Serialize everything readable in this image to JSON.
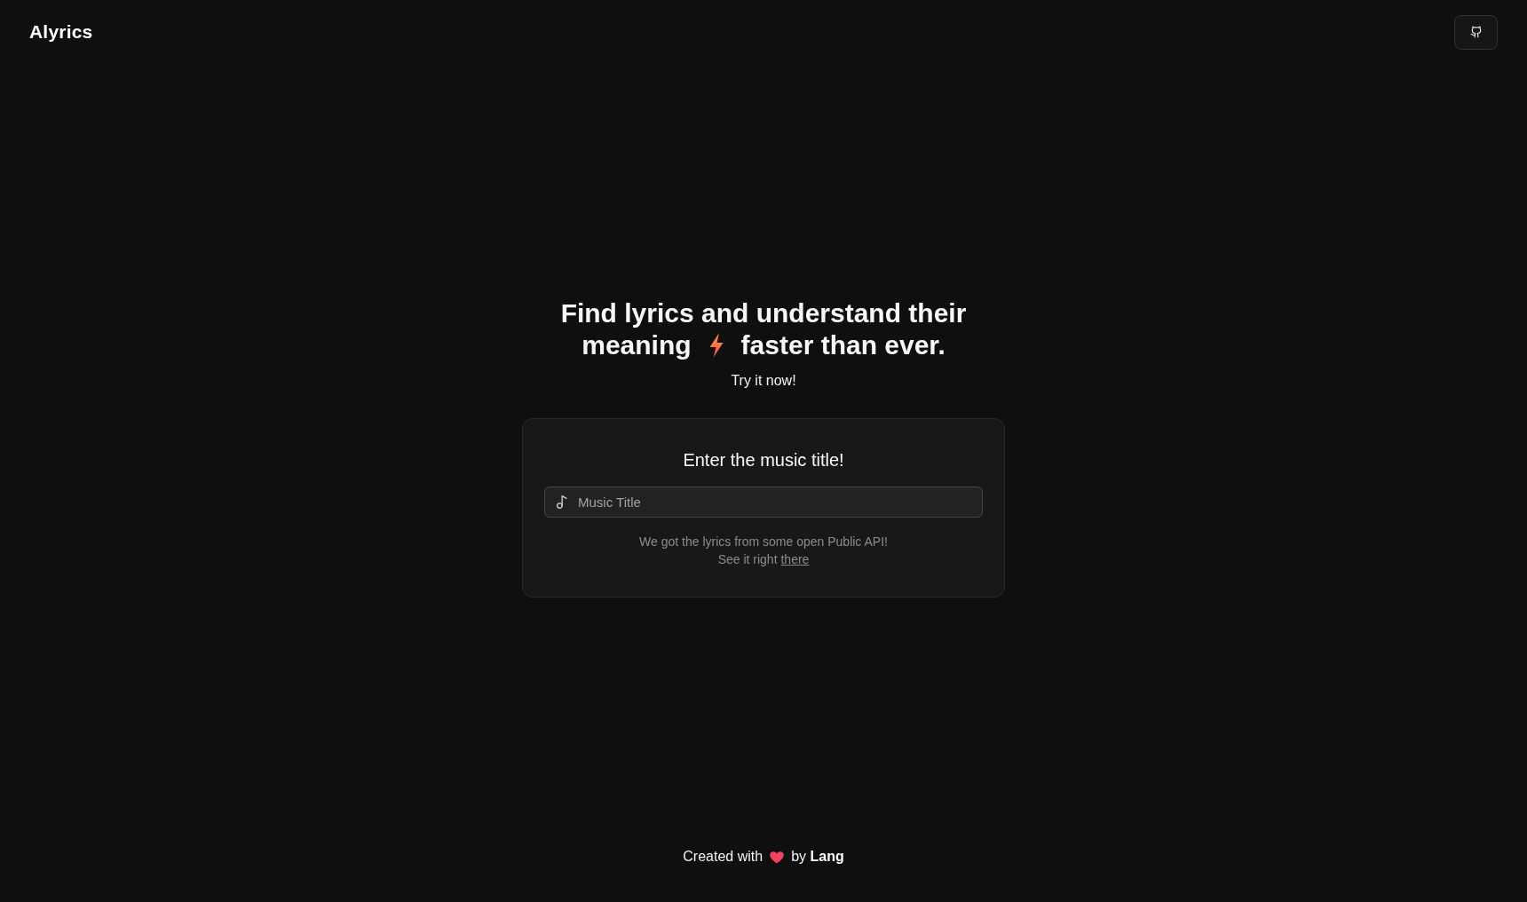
{
  "header": {
    "logo": "Alyrics"
  },
  "hero": {
    "heading": {
      "first_line": "Find lyrics and understand their",
      "before_icon": "meaning",
      "after_icon": "faster than ever."
    },
    "subtitle": "Try it now!"
  },
  "search_card": {
    "title": "Enter the music title!",
    "field": {
      "placeholder": "Music Title"
    },
    "note": "We got the lyrics from some open Public API!",
    "source": {
      "text": "See it right",
      "link": "there"
    }
  },
  "footer": {
    "before_icon": "Created with",
    "after_icon": "by **Lang**"
  }
}
